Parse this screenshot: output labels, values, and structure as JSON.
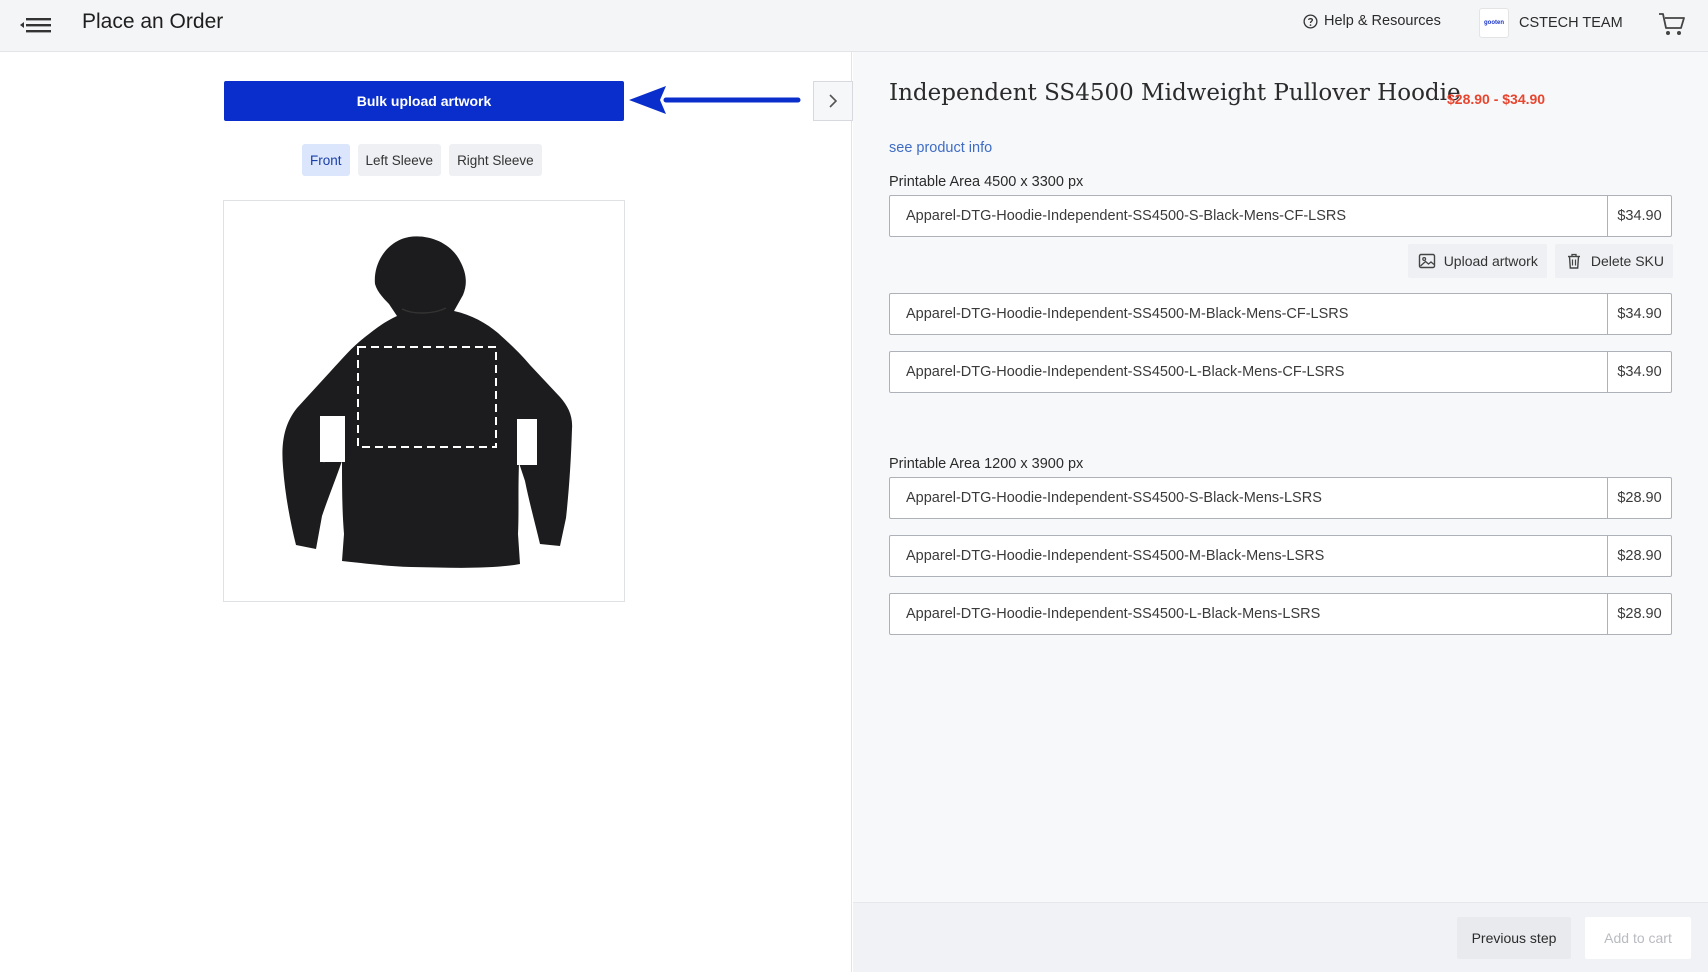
{
  "header": {
    "title": "Place an Order",
    "help_label": "Help & Resources",
    "team_logo_text": "gooten",
    "team_name": "CSTECH TEAM"
  },
  "left": {
    "bulk_upload_label": "Bulk upload artwork",
    "views": [
      {
        "label": "Front",
        "active": true
      },
      {
        "label": "Left Sleeve",
        "active": false
      },
      {
        "label": "Right Sleeve",
        "active": false
      }
    ]
  },
  "product": {
    "title": "Independent SS4500 Midweight Pullover Hoodie",
    "price_range": "$28.90 - $34.90",
    "info_link": "see product info"
  },
  "areas": [
    {
      "label": "Printable Area 4500 x 3300 px",
      "skus": [
        {
          "name": "Apparel-DTG-Hoodie-Independent-SS4500-S-Black-Mens-CF-LSRS",
          "price": "$34.90"
        },
        {
          "name": "Apparel-DTG-Hoodie-Independent-SS4500-M-Black-Mens-CF-LSRS",
          "price": "$34.90"
        },
        {
          "name": "Apparel-DTG-Hoodie-Independent-SS4500-L-Black-Mens-CF-LSRS",
          "price": "$34.90"
        }
      ]
    },
    {
      "label": "Printable Area 1200 x 3900 px",
      "skus": [
        {
          "name": "Apparel-DTG-Hoodie-Independent-SS4500-S-Black-Mens-LSRS",
          "price": "$28.90"
        },
        {
          "name": "Apparel-DTG-Hoodie-Independent-SS4500-M-Black-Mens-LSRS",
          "price": "$28.90"
        },
        {
          "name": "Apparel-DTG-Hoodie-Independent-SS4500-L-Black-Mens-LSRS",
          "price": "$28.90"
        }
      ]
    }
  ],
  "sku_actions": {
    "upload_label": "Upload artwork",
    "delete_label": "Delete SKU"
  },
  "footer": {
    "previous_label": "Previous step",
    "add_to_cart_label": "Add to cart"
  },
  "colors": {
    "primary": "#0a2ecc",
    "price": "#e8452f",
    "link": "#3f6cc4",
    "annotation_arrow": "#0a2ecc"
  },
  "icons": [
    "menu-collapse-icon",
    "help-circle-icon",
    "cart-icon",
    "chevron-right-icon",
    "image-upload-icon",
    "trash-icon",
    "annotation-arrow"
  ]
}
